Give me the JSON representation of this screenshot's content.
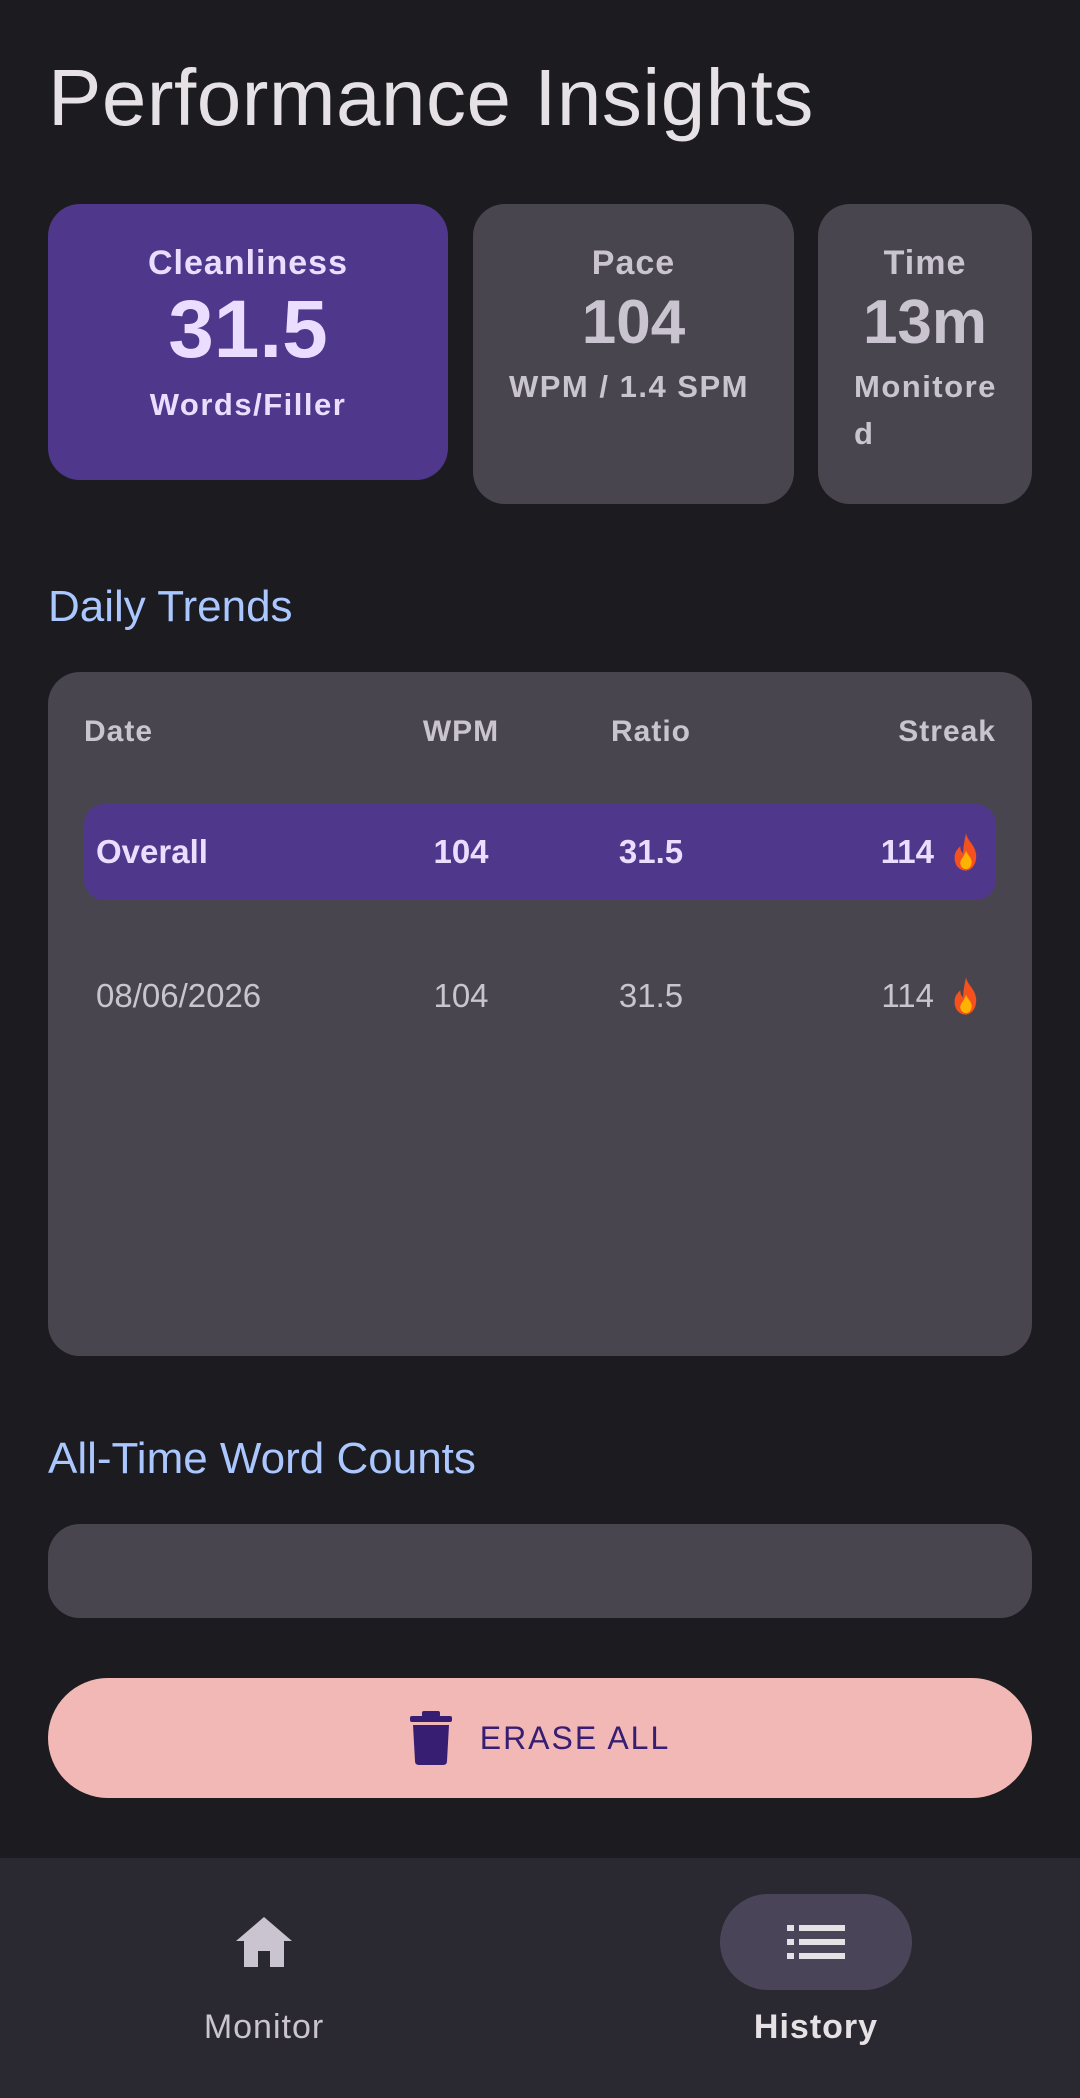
{
  "page": {
    "title": "Performance Insights"
  },
  "stats": {
    "cleanliness": {
      "label": "Cleanliness",
      "value": "31.5",
      "sub": "Words/Filler"
    },
    "pace": {
      "label": "Pace",
      "value": "104",
      "sub": "WPM / 1.4 SPM"
    },
    "time": {
      "label": "Time",
      "value": "13m",
      "sub": "Monitored"
    }
  },
  "trends": {
    "title": "Daily Trends",
    "headers": {
      "date": "Date",
      "wpm": "WPM",
      "ratio": "Ratio",
      "streak": "Streak"
    },
    "overall": {
      "date": "Overall",
      "wpm": "104",
      "ratio": "31.5",
      "streak": "114"
    },
    "rows": [
      {
        "date": "08/06/2026",
        "wpm": "104",
        "ratio": "31.5",
        "streak": "114"
      }
    ]
  },
  "word_counts": {
    "title": "All-Time Word Counts"
  },
  "erase": {
    "label": "ERASE ALL"
  },
  "nav": {
    "items": [
      {
        "label": "Monitor",
        "icon": "home-icon"
      },
      {
        "label": "History",
        "icon": "list-icon",
        "selected": true
      }
    ]
  },
  "colors": {
    "background": "#1c1b20",
    "card": "#49454f",
    "accent": "#4f378b",
    "section_title": "#aac7ff",
    "danger_button": "#f2b8b5"
  }
}
